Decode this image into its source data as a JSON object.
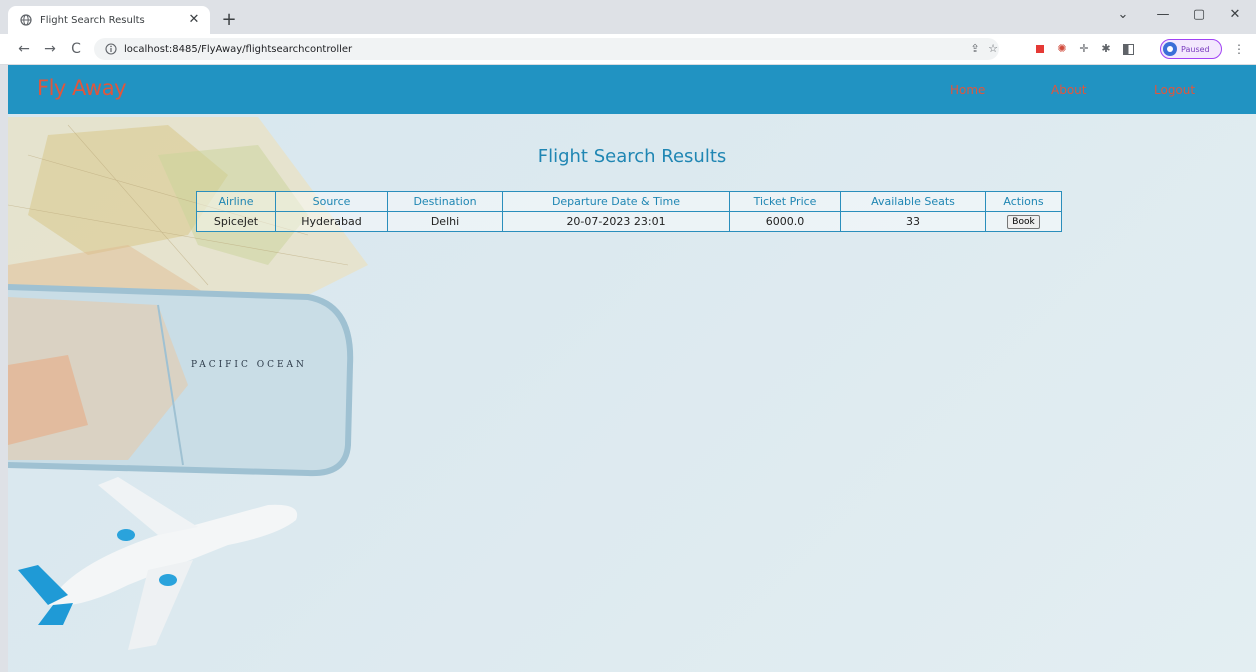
{
  "browser": {
    "tab_title": "Flight Search Results",
    "url": "localhost:8485/FlyAway/flightsearchcontroller",
    "profile_label": "Paused"
  },
  "app": {
    "brand": "Fly Away",
    "nav": [
      "Home",
      "About",
      "Logout"
    ],
    "brand_color": "#e0563d",
    "header_color": "#2193c2"
  },
  "page": {
    "title": "Flight Search Results",
    "table": {
      "headers": [
        "Airline",
        "Source",
        "Destination",
        "Departure Date & Time",
        "Ticket Price",
        "Available Seats",
        "Actions"
      ],
      "rows": [
        {
          "airline": "SpiceJet",
          "source": "Hyderabad",
          "destination": "Delhi",
          "departure": "20-07-2023 23:01",
          "price": "6000.0",
          "seats": "33",
          "action": "Book"
        }
      ]
    },
    "background_caption": "PACIFIC OCEAN"
  }
}
